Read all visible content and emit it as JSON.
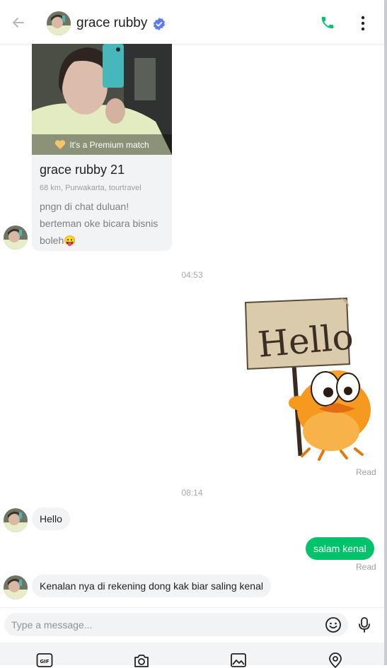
{
  "header": {
    "contact_name": "grace rubby"
  },
  "match_card": {
    "premium_label": "It's a Premium match",
    "name_age": "grace rubby 21",
    "meta": "68 km, Purwakarta, tourtravel",
    "bio": "pngn di chat duluan! berteman oke bicara bisnis boleh😛"
  },
  "messages": {
    "time_1": "04:53",
    "sticker_text": "Hello",
    "sticker_status": "Read",
    "time_2": "08:14",
    "in_1": "Hello",
    "out_1": "salam kenal",
    "out_1_status": "Read",
    "in_2": "Kenalan nya di rekening dong kak biar saling kenal"
  },
  "composer": {
    "placeholder": "Type a message..."
  },
  "colors": {
    "accent_green": "#00c26a",
    "verified_blue": "#5b7cf0",
    "bubble_gray": "#f2f3f5"
  },
  "icons": {
    "back": "arrow-left-icon",
    "verified": "verified-badge-icon",
    "call": "phone-icon",
    "more": "more-vertical-icon",
    "emoji": "smiley-icon",
    "mic": "microphone-icon",
    "gif": "gif-icon",
    "camera": "camera-icon",
    "gallery": "image-icon",
    "location": "location-pin-icon"
  }
}
